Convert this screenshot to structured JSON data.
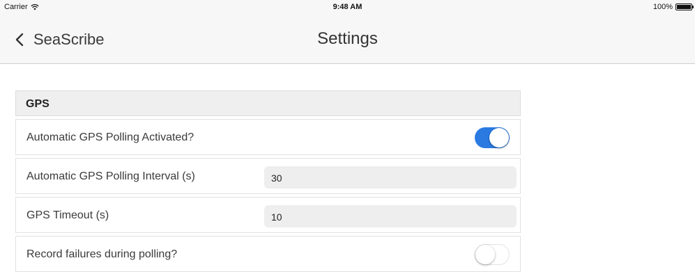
{
  "status_bar": {
    "carrier": "Carrier",
    "time": "9:48 AM",
    "battery": "100%"
  },
  "nav": {
    "back_label": "SeaScribe",
    "title": "Settings"
  },
  "section": {
    "title": "GPS"
  },
  "settings": {
    "auto_polling": {
      "label": "Automatic GPS Polling Activated?",
      "enabled": true
    },
    "polling_interval": {
      "label": "Automatic GPS Polling Interval (s)",
      "value": "30"
    },
    "gps_timeout": {
      "label": "GPS Timeout (s)",
      "value": "10"
    },
    "record_failures": {
      "label": "Record failures during polling?",
      "enabled": false
    }
  },
  "colors": {
    "toggle_on": "#2a7ae2",
    "nav_background": "#f7f7f7"
  }
}
